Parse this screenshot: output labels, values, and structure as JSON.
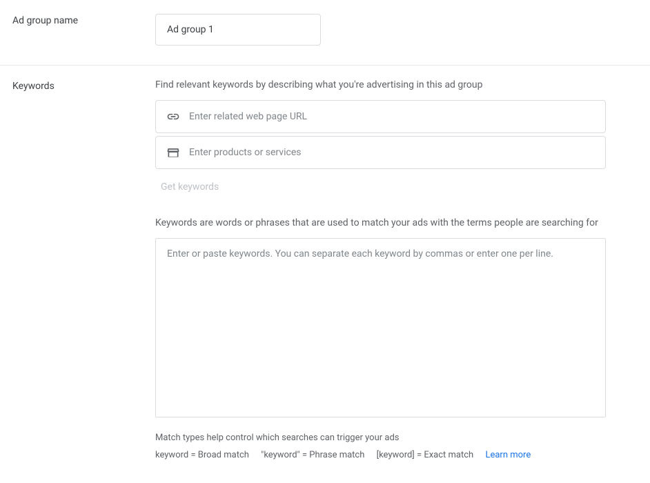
{
  "ad_group": {
    "label": "Ad group name",
    "value": "Ad group 1"
  },
  "keywords": {
    "label": "Keywords",
    "hint": "Find relevant keywords by describing what you're advertising in this ad group",
    "url_placeholder": "Enter related web page URL",
    "products_placeholder": "Enter products or services",
    "get_keywords_label": "Get keywords",
    "description": "Keywords are words or phrases that are used to match your ads with the terms people are searching for",
    "textarea_placeholder": "Enter or paste keywords. You can separate each keyword by commas or enter one per line.",
    "helper_line1": "Match types help control which searches can trigger your ads",
    "broad": "keyword = Broad match",
    "phrase": "\"keyword\" = Phrase match",
    "exact": "[keyword] = Exact match",
    "learn_more": "Learn more"
  }
}
